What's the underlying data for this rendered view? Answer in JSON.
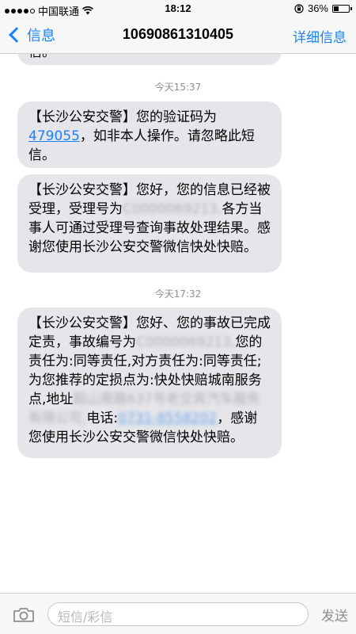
{
  "status_bar": {
    "carrier": "中国联通",
    "time": "18:12",
    "battery": "36%",
    "battery_level": 0.36
  },
  "nav": {
    "back_label": "信息",
    "title": "10690861310405",
    "detail_label": "详细信息"
  },
  "messages": {
    "prev_bubble_tail": "信。",
    "timestamp_1": "今天15:37",
    "msg1": {
      "prefix": "【长沙公安交警】您的验证码为",
      "code": "479055",
      "suffix": "，如非本人操作。请忽略此短信。"
    },
    "msg2": {
      "part1": "【长沙公安交警】您好，您的信息已经被受理，受理号为",
      "redacted": "C0000069213,",
      "part2": "各方当事人可通过受理号查询事故处理结果。感谢您使用长沙公安交警微信快处快赔。"
    },
    "timestamp_2": "今天17:32",
    "msg3": {
      "part1": "【长沙公安交警】您好、您的事故已完成定责，事故编号为",
      "redacted_id": "C0000069213,",
      "part2": "您的责任为:同等责任,对方责任为:同等责任;为您推荐的定损点为:快处快赔城南服务点,地址",
      "redacted_addr": "韶山南路637号老交宾汽车服务有限公司,",
      "part3": "电话:",
      "redacted_phone": "0731-8558202",
      "part4": "，感谢您使用长沙公安交警微信快处快赔。"
    }
  },
  "input_bar": {
    "placeholder": "短信/彩信",
    "send_label": "发送",
    "camera_icon": "camera-icon"
  },
  "colors": {
    "accent": "#1a82fb",
    "bubble": "#e5e5ea",
    "timestamp": "#8e8e93"
  }
}
